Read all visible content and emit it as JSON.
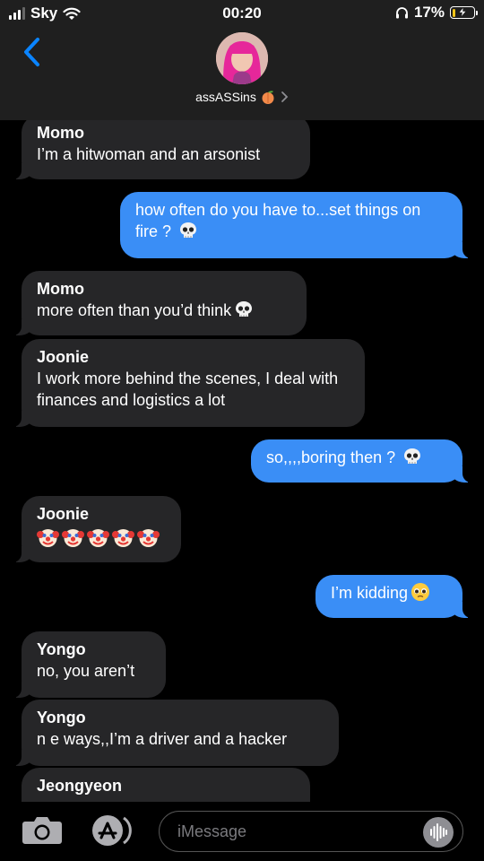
{
  "status_bar": {
    "carrier": "Sky",
    "time": "00:20",
    "battery": "17%"
  },
  "header": {
    "contact_name": "assASSins",
    "contact_emoji": "peach-icon"
  },
  "messages": [
    {
      "direction": "in",
      "sender": "Momo",
      "text": "I’m a hitwoman and an arsonist"
    },
    {
      "direction": "out",
      "text": "how often do you have to...set things on fire ?",
      "emoji": "skull-icon"
    },
    {
      "direction": "in",
      "sender": "Momo",
      "text": "more often than you’d think",
      "emoji": "skull-icon"
    },
    {
      "direction": "in",
      "sender": "Joonie",
      "text": "I work more behind the scenes, I deal with finances and logistics a lot"
    },
    {
      "direction": "out",
      "text": "so,,,,boring then ?",
      "emoji": "skull-icon"
    },
    {
      "direction": "in",
      "sender": "Joonie",
      "emoji_row": "clown-face-icon x5"
    },
    {
      "direction": "out",
      "text": "I’m kidding",
      "emoji": "pleading-face-icon"
    },
    {
      "direction": "in",
      "sender": "Yongo",
      "text": "no, you aren’t"
    },
    {
      "direction": "in",
      "sender": "Yongo",
      "text": "n e ways,,I’m a driver and a hacker"
    },
    {
      "direction": "in",
      "sender": "Jeongyeon",
      "text": ""
    }
  ],
  "composer": {
    "placeholder": "iMessage"
  },
  "colors": {
    "outgoing_bubble": "#3a8ef6",
    "incoming_bubble": "#262628",
    "header_bg": "#1f1f1f",
    "accent": "#0a84ff"
  }
}
